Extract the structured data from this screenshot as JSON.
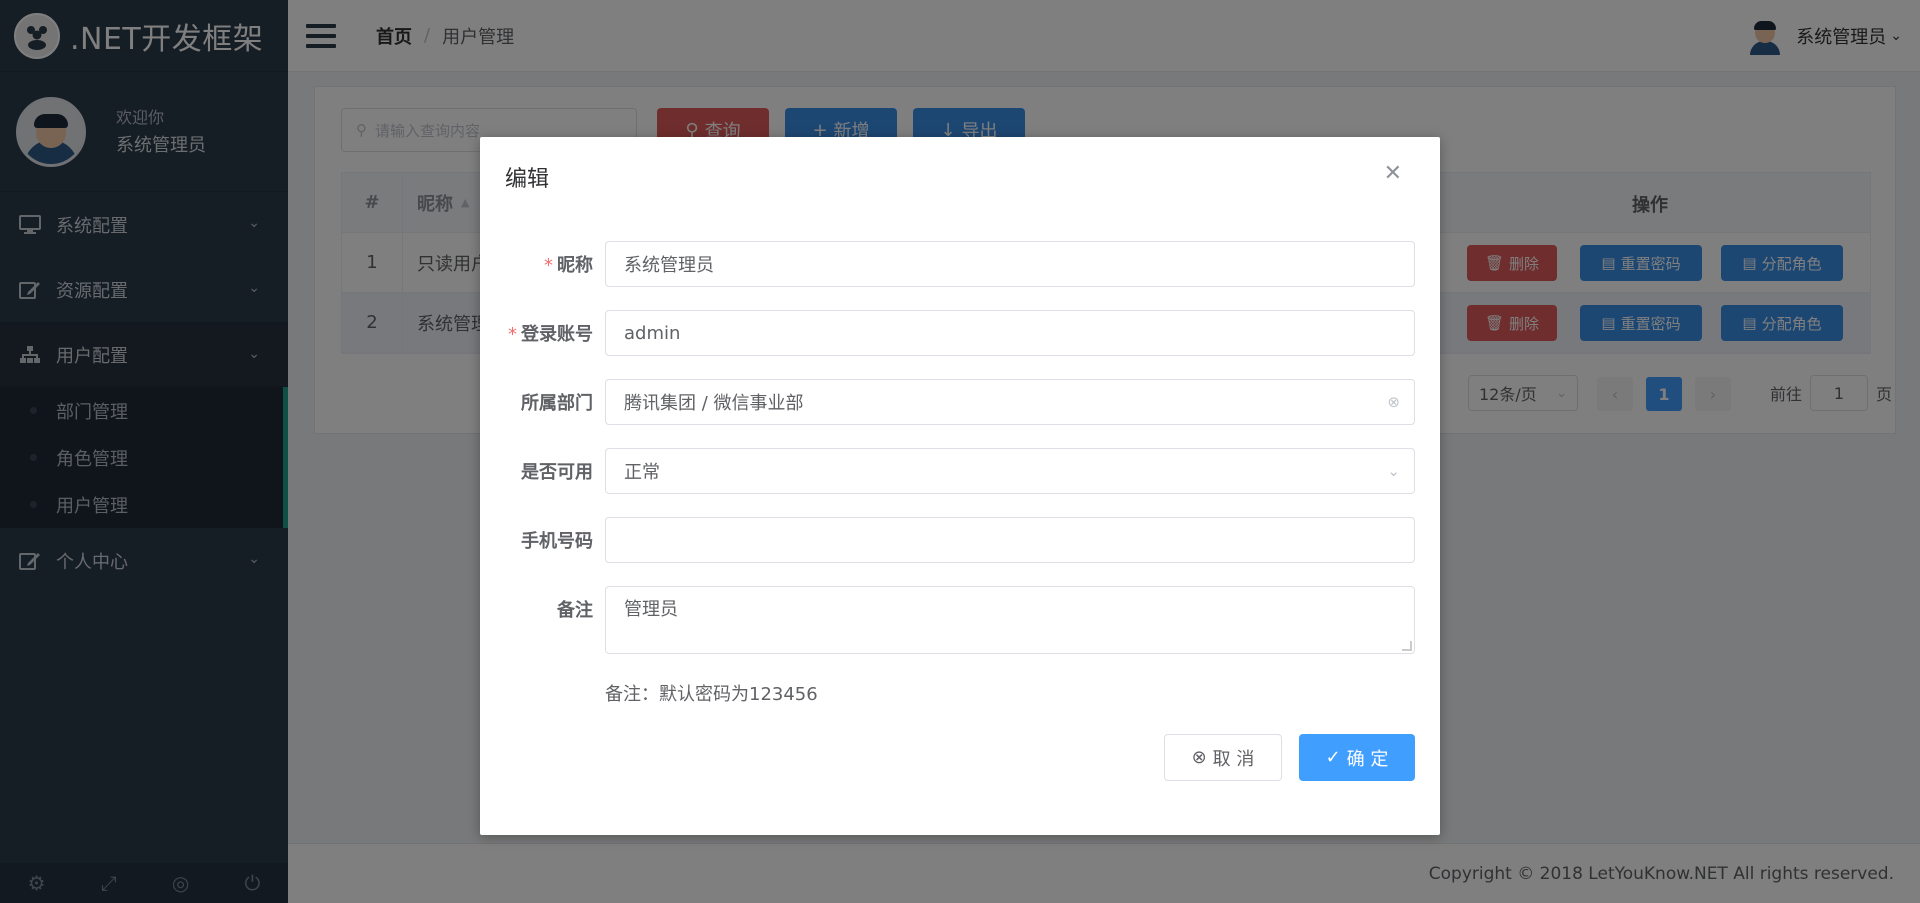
{
  "app": {
    "logo_text": ".NET开发框架"
  },
  "sidebar": {
    "welcome": "欢迎你",
    "username": "系统管理员",
    "menu": [
      {
        "label": "系统配置",
        "icon": "monitor-icon"
      },
      {
        "label": "资源配置",
        "icon": "edit-icon"
      },
      {
        "label": "用户配置",
        "icon": "sitemap-icon"
      },
      {
        "label": "个人中心",
        "icon": "edit-icon"
      }
    ],
    "submenu": [
      {
        "label": "部门管理"
      },
      {
        "label": "角色管理"
      },
      {
        "label": "用户管理"
      }
    ]
  },
  "topbar": {
    "breadcrumb_home": "首页",
    "breadcrumb_sep": "/",
    "breadcrumb_current": "用户管理",
    "user": "系统管理员"
  },
  "toolbar": {
    "search_placeholder": "请输入查询内容",
    "query": "查询",
    "add": "新增",
    "export": "导出"
  },
  "table": {
    "headers": {
      "idx": "#",
      "nick": "昵称",
      "ops": "操作"
    },
    "rows": [
      {
        "idx": "1",
        "nick": "只读用户"
      },
      {
        "idx": "2",
        "nick": "系统管理"
      }
    ],
    "op_labels": {
      "delete": "删除",
      "reset": "重置密码",
      "assign": "分配角色"
    }
  },
  "pagination": {
    "page_size": "12条/页",
    "current_page": "1",
    "goto_label": "前往",
    "goto_value": "1",
    "page_unit": "页"
  },
  "footer": {
    "copyright": "Copyright © 2018 LetYouKnow.NET All rights reserved."
  },
  "dialog": {
    "title": "编辑",
    "fields": {
      "nickname": {
        "label": "昵称",
        "value": "系统管理员",
        "required": true
      },
      "account": {
        "label": "登录账号",
        "value": "admin",
        "required": true
      },
      "department": {
        "label": "所属部门",
        "value": "腾讯集团 / 微信事业部"
      },
      "enabled": {
        "label": "是否可用",
        "value": "正常"
      },
      "phone": {
        "label": "手机号码",
        "value": ""
      },
      "remark": {
        "label": "备注",
        "value": "管理员"
      }
    },
    "hint": "备注：默认密码为123456",
    "cancel": "取 消",
    "confirm": "确 定"
  },
  "colors": {
    "sidebar_bg": "#2b3a4a",
    "primary": "#409eff",
    "danger": "#e05b5b",
    "accent_green": "#1f9e8a"
  }
}
